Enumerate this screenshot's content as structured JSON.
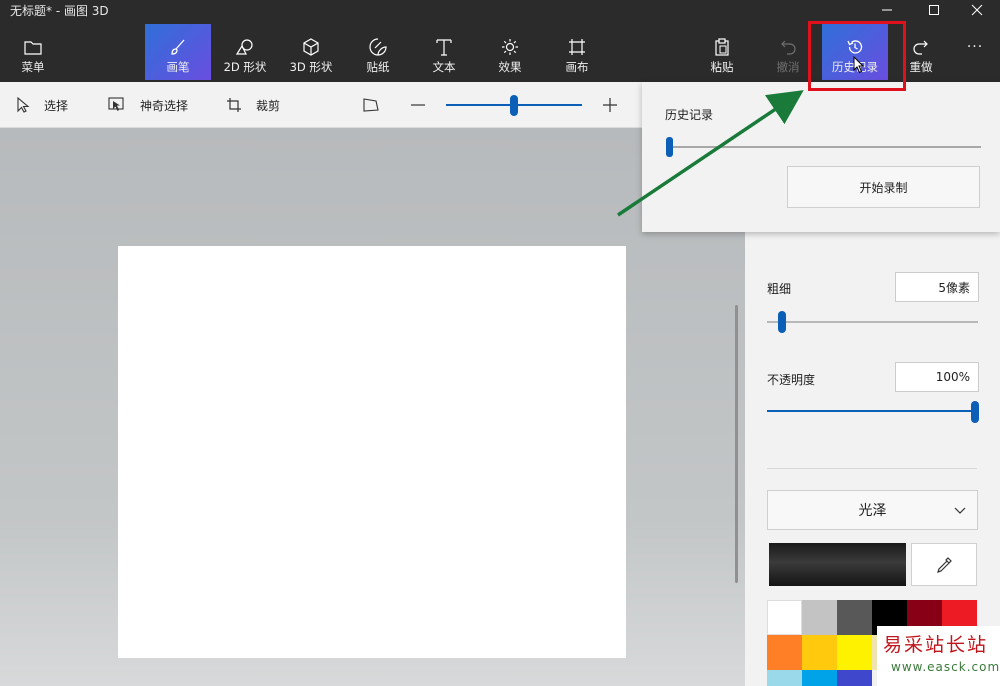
{
  "window": {
    "title": "无标题* - 画图 3D"
  },
  "toolbar": {
    "menu_label": "菜单",
    "brushes_label": "画笔",
    "shapes2d_label": "2D 形状",
    "shapes3d_label": "3D 形状",
    "stickers_label": "贴纸",
    "text_label": "文本",
    "effects_label": "效果",
    "canvas_label": "画布",
    "paste_label": "粘贴",
    "undo_label": "撤消",
    "history_label": "历史记录",
    "redo_label": "重做",
    "more_glyph": "···"
  },
  "subbar": {
    "select_label": "选择",
    "magic_select_label": "神奇选择",
    "crop_label": "裁剪"
  },
  "history_panel": {
    "title": "历史记录",
    "record_label": "开始录制",
    "position": 0
  },
  "brush_settings": {
    "thickness_label": "粗细",
    "thickness_value": "5像素",
    "thickness_fraction": 0.05,
    "opacity_label": "不透明度",
    "opacity_value": "100%",
    "opacity_fraction": 1.0,
    "finish_label": "光泽"
  },
  "palette": [
    "#ffffff",
    "#c3c3c3",
    "#585858",
    "#000000",
    "#880015",
    "#ed1c24",
    "#ff7f27",
    "#ffc90e",
    "#fff200",
    "#efe4b0",
    "#22b14c",
    "#b5e61d",
    "#99d9ea",
    "#00a2e8",
    "#3f48cc"
  ],
  "watermark": {
    "text": "易采站长站",
    "url": "www.easck.com"
  },
  "colors": {
    "accent": "#0b5fb7",
    "highlight": "#e0101c",
    "arrow": "#1a7a3a"
  }
}
